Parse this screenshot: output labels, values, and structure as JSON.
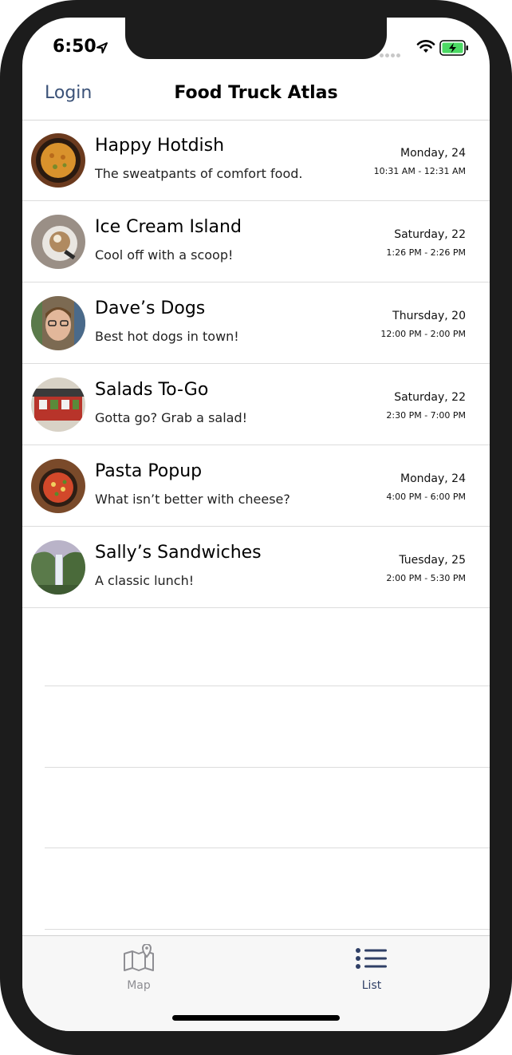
{
  "status": {
    "time": "6:50"
  },
  "nav": {
    "login": "Login",
    "title": "Food Truck Atlas"
  },
  "trucks": [
    {
      "name": "Happy Hotdish",
      "tagline": "The sweatpants of comfort food.",
      "date": "Monday, 24",
      "hours": "10:31 AM - 12:31 AM"
    },
    {
      "name": "Ice Cream Island",
      "tagline": "Cool off with a scoop!",
      "date": "Saturday, 22",
      "hours": "1:26 PM - 2:26 PM"
    },
    {
      "name": "Dave’s Dogs",
      "tagline": "Best hot dogs in town!",
      "date": "Thursday, 20",
      "hours": "12:00 PM - 2:00 PM"
    },
    {
      "name": "Salads To-Go",
      "tagline": "Gotta go? Grab a salad!",
      "date": "Saturday, 22",
      "hours": "2:30 PM - 7:00 PM"
    },
    {
      "name": "Pasta Popup",
      "tagline": "What isn’t better with cheese?",
      "date": "Monday, 24",
      "hours": "4:00 PM - 6:00 PM"
    },
    {
      "name": "Sally’s Sandwiches",
      "tagline": "A classic lunch!",
      "date": "Tuesday, 25",
      "hours": "2:00 PM - 5:30 PM"
    }
  ],
  "tabs": {
    "map": "Map",
    "list": "List",
    "selected": "list"
  },
  "colors": {
    "accent": "#3b5278",
    "tab_selected": "#2f3f66",
    "tab_unselected": "#8e8e93"
  },
  "icons": {
    "map_tab": "map-icon",
    "list_tab": "list-icon"
  }
}
